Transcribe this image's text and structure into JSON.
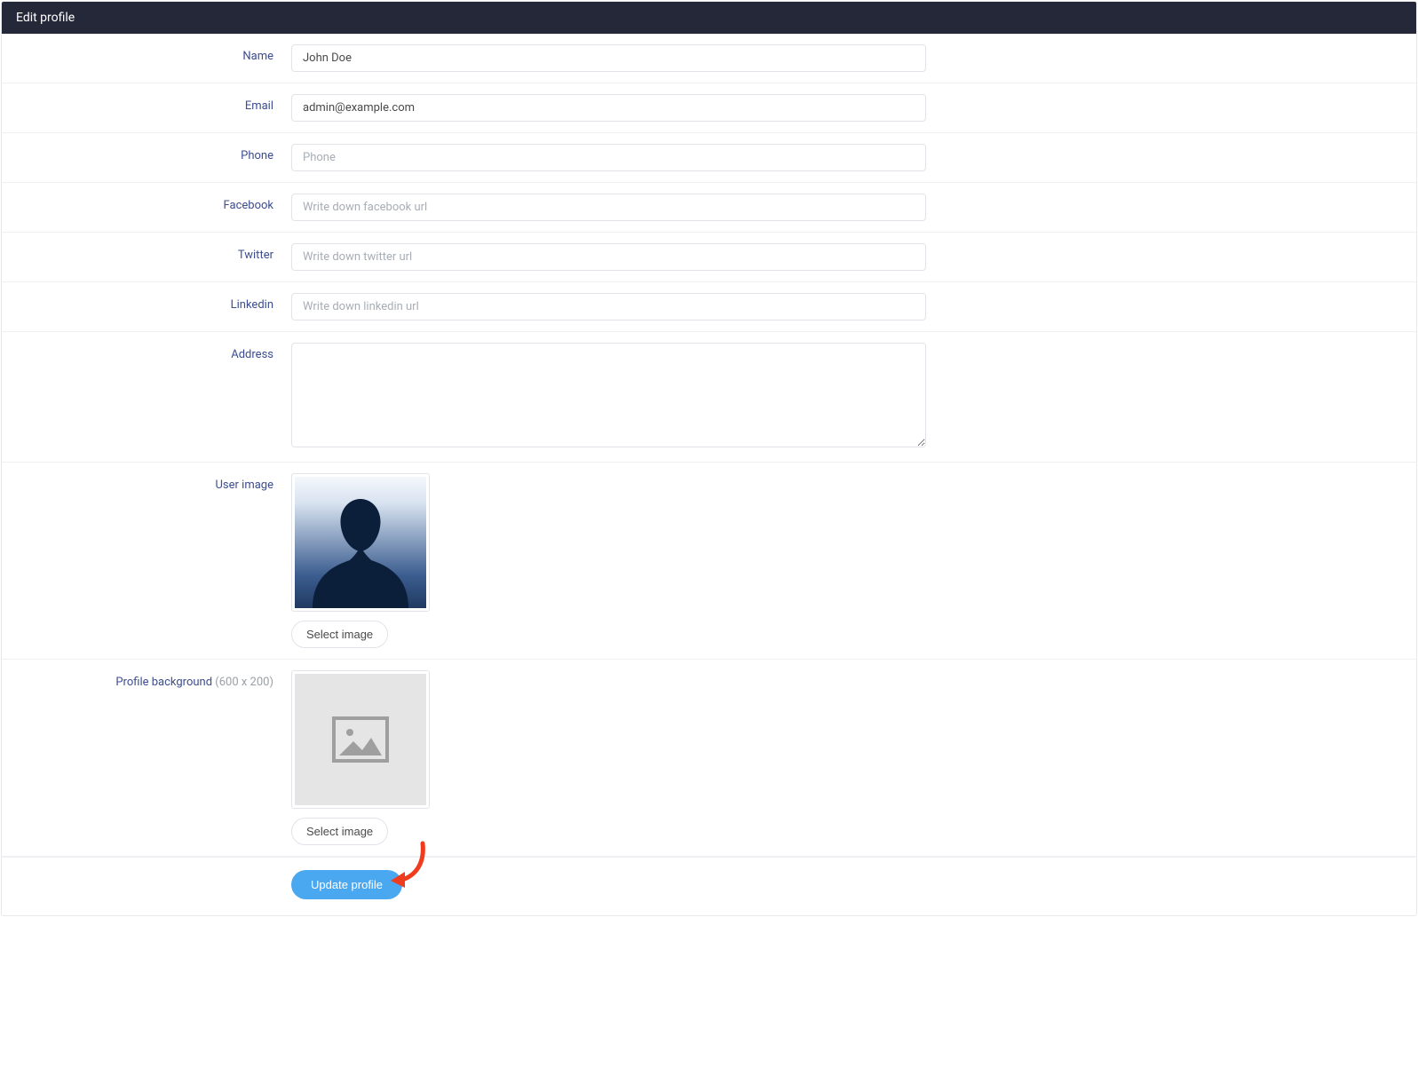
{
  "header": {
    "title": "Edit profile"
  },
  "form": {
    "name": {
      "label": "Name",
      "value": "John Doe",
      "placeholder": ""
    },
    "email": {
      "label": "Email",
      "value": "admin@example.com",
      "placeholder": ""
    },
    "phone": {
      "label": "Phone",
      "value": "",
      "placeholder": "Phone"
    },
    "facebook": {
      "label": "Facebook",
      "value": "",
      "placeholder": "Write down facebook url"
    },
    "twitter": {
      "label": "Twitter",
      "value": "",
      "placeholder": "Write down twitter url"
    },
    "linkedin": {
      "label": "Linkedin",
      "value": "",
      "placeholder": "Write down linkedin url"
    },
    "address": {
      "label": "Address",
      "value": "",
      "placeholder": ""
    },
    "user_image": {
      "label": "User image",
      "select_button": "Select image"
    },
    "profile_background": {
      "label": "Profile background ",
      "hint": "(600 x 200)",
      "select_button": "Select image"
    }
  },
  "actions": {
    "submit_label": "Update profile"
  }
}
